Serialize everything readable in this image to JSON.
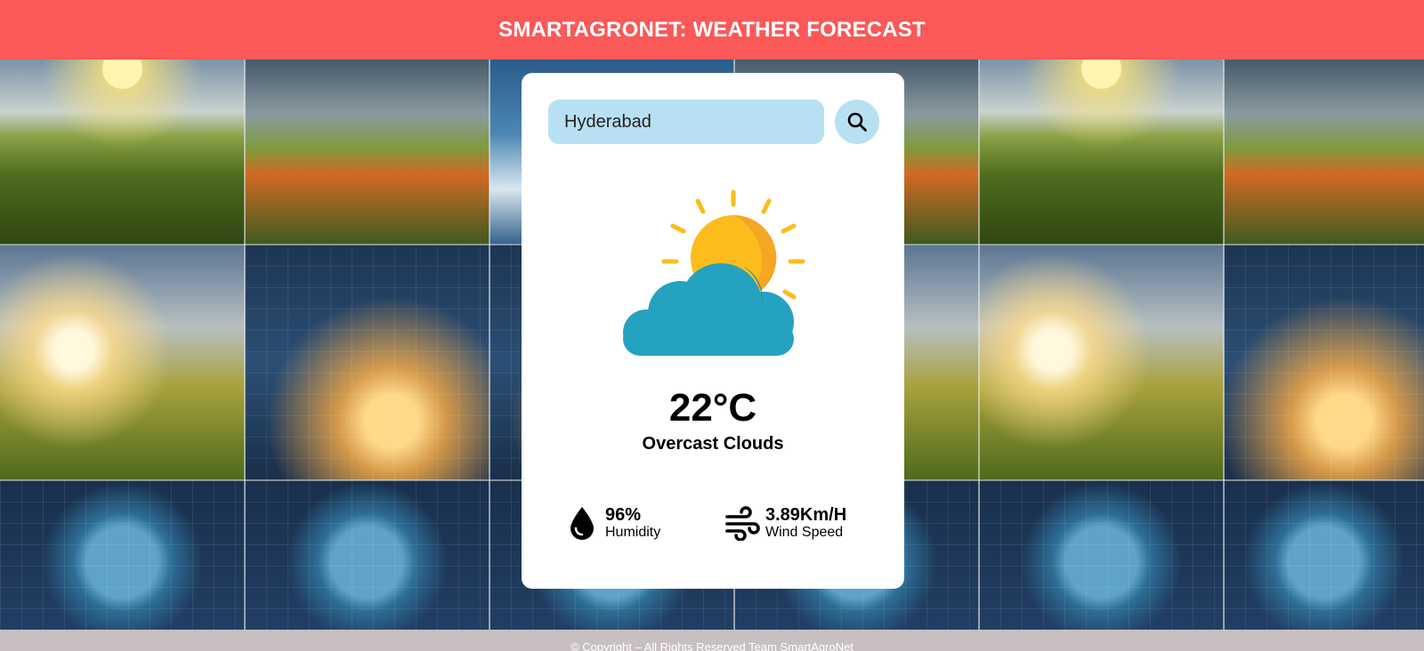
{
  "header": {
    "title": "SMARTAGRONET: WEATHER FORECAST"
  },
  "search": {
    "value": "Hyderabad",
    "icon": "search-icon"
  },
  "weather": {
    "icon": "partly-cloudy-icon",
    "temperature": "22°C",
    "condition": "Overcast Clouds"
  },
  "details": {
    "humidity": {
      "value": "96%",
      "label": "Humidity",
      "icon": "humidity-drop-icon"
    },
    "wind": {
      "value": "3.89Km/H",
      "label": "Wind Speed",
      "icon": "wind-icon"
    }
  },
  "footer": {
    "text": "© Copyright – All Rights Reserved Team SmartAgroNet"
  },
  "colors": {
    "header_bg": "#fb5858",
    "input_bg": "#b8e0f3",
    "sun": "#fbbd1b",
    "cloud": "#25a2c0",
    "footer_bg": "#c8c0c0"
  }
}
